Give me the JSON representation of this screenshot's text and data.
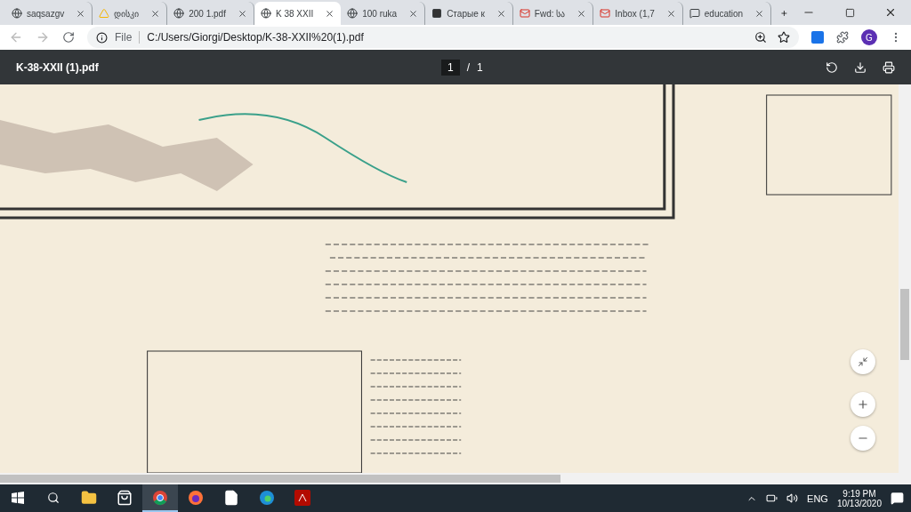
{
  "tabs": [
    {
      "title": "saqsazgv",
      "kind": "globe",
      "selected": false
    },
    {
      "title": "დისკი",
      "kind": "drive",
      "selected": false
    },
    {
      "title": "200 1.pdf",
      "kind": "globe",
      "selected": false
    },
    {
      "title": "K 38 XXII",
      "kind": "globe",
      "selected": true
    },
    {
      "title": "100 ruka",
      "kind": "globe",
      "selected": false
    },
    {
      "title": "Старые к",
      "kind": "square",
      "selected": false
    },
    {
      "title": "Fwd: სა",
      "kind": "mail",
      "selected": false
    },
    {
      "title": "Inbox (1,7",
      "kind": "mail",
      "selected": false
    },
    {
      "title": "education",
      "kind": "chat",
      "selected": false
    }
  ],
  "address": {
    "scheme": "File",
    "url": "C:/Users/Giorgi/Desktop/K-38-XXII%20(1).pdf"
  },
  "profile": {
    "initial": "G"
  },
  "pdf_toolbar": {
    "title": "K-38-XXII (1).pdf",
    "page": "1",
    "separator": "/",
    "total": "1"
  },
  "taskbar": {
    "apps": [
      {
        "kind": "explorer",
        "selected": false
      },
      {
        "kind": "store",
        "selected": false
      },
      {
        "kind": "chrome",
        "selected": true
      },
      {
        "kind": "firefox",
        "selected": false
      },
      {
        "kind": "file",
        "selected": false
      },
      {
        "kind": "edge",
        "selected": false
      },
      {
        "kind": "acrobat",
        "selected": false
      }
    ],
    "language": "ENG",
    "time": "9:19 PM",
    "date": "10/13/2020"
  }
}
